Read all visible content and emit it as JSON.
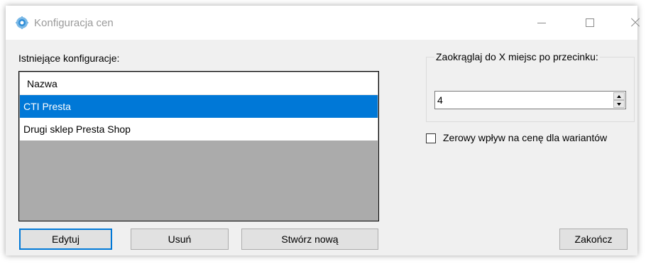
{
  "window": {
    "title": "Konfiguracja cen",
    "icon": "gear-blue-icon",
    "controls": [
      "minimize-icon",
      "maximize-icon",
      "close-icon"
    ]
  },
  "configurations": {
    "label": "Istniejące konfiguracje:",
    "column_header": "Nazwa",
    "rows": [
      {
        "name": "CTI Presta",
        "selected": true
      },
      {
        "name": "Drugi sklep Presta Shop",
        "selected": false
      }
    ]
  },
  "buttons": {
    "edit": "Edytuj",
    "delete": "Usuń",
    "create_new": "Stwórz nową",
    "finish": "Zakończ"
  },
  "rounding": {
    "label": "Zaokrąglaj do X miejsc po przecinku:",
    "value": "4"
  },
  "zero_impact": {
    "label": "Zerowy wpływ na cenę dla wariantów",
    "checked": false
  },
  "colors": {
    "selection": "#0078d7",
    "list_background": "#ababab",
    "window_background": "#f0f0f0"
  }
}
